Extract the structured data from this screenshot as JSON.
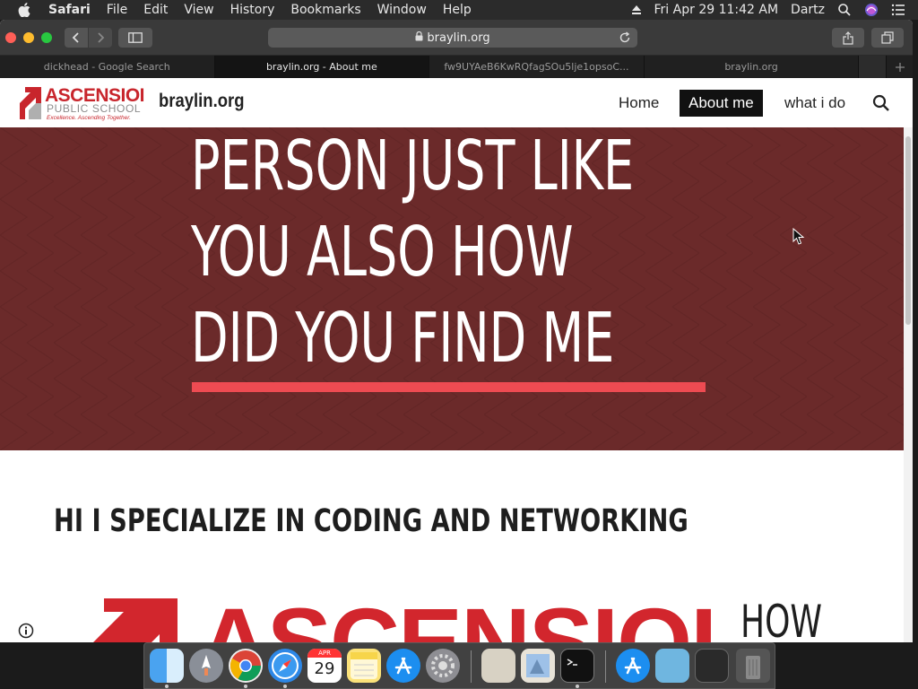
{
  "menubar": {
    "app_name": "Safari",
    "menus": [
      "File",
      "Edit",
      "View",
      "History",
      "Bookmarks",
      "Window",
      "Help"
    ],
    "datetime": "Fri Apr 29  11:42 AM",
    "user": "Dartz"
  },
  "browser": {
    "address": "braylin.org",
    "tabs": [
      {
        "label": "dickhead - Google Search",
        "active": false
      },
      {
        "label": "braylin.org - About me",
        "active": true
      },
      {
        "label": "fw9UYAeB6KwRQfagSOu5lje1opsoC...",
        "active": false
      },
      {
        "label": "braylin.org",
        "active": false
      }
    ]
  },
  "site": {
    "logo": {
      "word": "ASCENSIOI",
      "sub": "PUBLIC SCHOOL",
      "tagline": "Excellence. Ascending Together."
    },
    "title": "braylin.org",
    "nav": {
      "home": "Home",
      "about": "About me",
      "what": "what i do"
    },
    "hero": {
      "lines": [
        "PERSON JUST LIKE",
        "YOU ALSO HOW",
        "DID YOU FIND ME"
      ]
    },
    "section_heading": "HI I SPECIALIZE IN CODING AND NETWORKING",
    "big_logo_word": "ASCENSIOI",
    "side_text": "HOW"
  },
  "dock": {
    "calendar_month": "APR",
    "calendar_day": "29"
  },
  "colors": {
    "hero_bg": "#6b2a2a",
    "accent_red": "#ee4b52",
    "brand_red": "#c8252c",
    "nav_active_bg": "#111111"
  }
}
